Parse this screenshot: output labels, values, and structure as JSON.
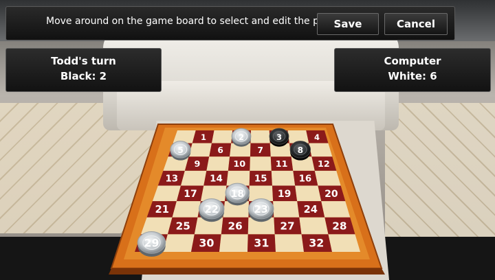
{
  "toolbar": {
    "message": "Move around on the game board to select and edit the pieces.",
    "save_label": "Save",
    "cancel_label": "Cancel"
  },
  "player_left": {
    "turn_label": "Todd's turn",
    "score_label": "Black: 2"
  },
  "player_right": {
    "name": "Computer",
    "score_label": "White: 6"
  },
  "board": {
    "squares": [
      "1",
      "2",
      "3",
      "4",
      "5",
      "6",
      "7",
      "8",
      "9",
      "10",
      "11",
      "12",
      "13",
      "14",
      "15",
      "16",
      "17",
      "18",
      "19",
      "20",
      "21",
      "22",
      "23",
      "24",
      "25",
      "26",
      "27",
      "28",
      "29",
      "30",
      "31",
      "32"
    ],
    "black_pieces": [
      3,
      8
    ],
    "white_pieces": [
      2,
      5,
      18,
      22,
      23,
      29
    ],
    "colors": {
      "dark_square": "#8b1a1a",
      "light_square": "#f1dfb6",
      "frame": "#e07a1c"
    }
  }
}
